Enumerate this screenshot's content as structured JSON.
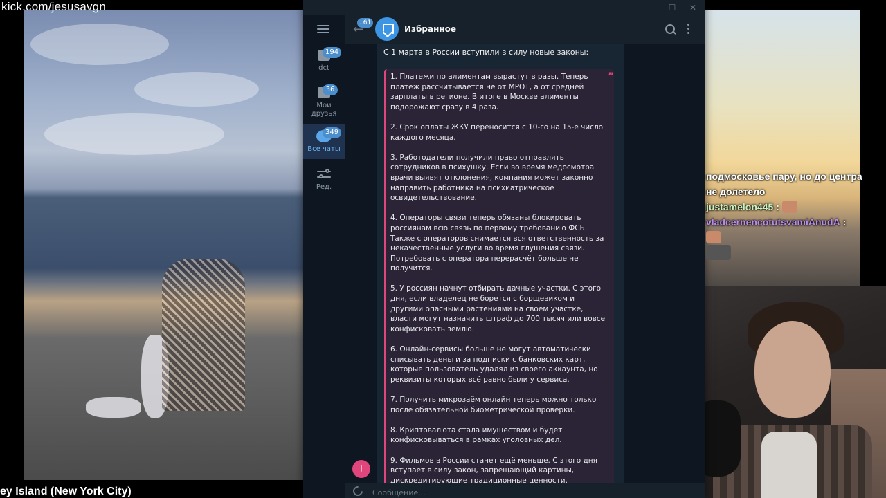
{
  "stream": {
    "url": "kick.com/jesusavgn",
    "cam_caption": "ey Island (New York City)"
  },
  "chat_overlay": {
    "line1": "подмосковье пару, но до центра",
    "line2": "не долетело",
    "user1": "justamelon445",
    "user1_sep": ":",
    "user2": "vladcernencotutsvamiAnudA",
    "user2_sep": ":"
  },
  "telegram": {
    "window_buttons": {
      "minimize": "—",
      "maximize": "☐",
      "close": "✕"
    },
    "folders": [
      {
        "label": "dct",
        "badge": "194"
      },
      {
        "label": "Мои друзья",
        "badge": "36"
      },
      {
        "label": "Все чаты",
        "badge": "349"
      },
      {
        "label": "Ред.",
        "badge": ""
      }
    ],
    "header": {
      "unread_count": "..61",
      "title": "Избранное"
    },
    "message": {
      "intro": "С 1 марта в России вступили в силу новые законы:",
      "quote_mark": "”",
      "points": [
        "1. Платежи по алиментам вырастут в разы. Теперь платёж рассчитывается не от МРОТ, а от средней зарплаты в регионе. В итоге в Москве алименты подорожают сразу в 4 раза.",
        "2. Срок оплаты ЖКУ переносится с 10-го на 15-е число каждого месяца.",
        "3. Работодатели получили право отправлять сотрудников в психушку. Если во время медосмотра врачи выявят отклонения, компания может законно направить работника на психиатрическое освидетельствование.",
        "4. Операторы связи теперь обязаны блокировать россиянам всю связь по первому требованию ФСБ. Также с операторов снимается вся ответственность за некачественные услуги во время глушения связи. Потребовать с оператора перерасчёт больше не получится.",
        "5. У россиян начнут отбирать дачные участки. С этого дня, если владелец не борется с борщевиком и другими опасными растениями на своём участке, власти могут назначить штраф до 700 тысяч или вовсе конфисковать землю.",
        "6. Онлайн-сервисы больше не могут автоматически списывать деньги за подписки с банковских карт, которые пользователь удалял из своего аккаунта, но реквизиты которых всё равно были у сервиса.",
        "7. Получить микрозаём онлайн теперь можно только после обязательной биометрической проверки.",
        "8. Криптовалюта стала имуществом и будет конфисковываться в рамках уголовных дел.",
        "9. Фильмов в России станет ещё меньше. С этого дня вступает в силу закон, запрещающий картины, дискредитирующие традиционные ценности. Кинотеатры обязаны убрать такие фильмы из офлайн- и онлайн-"
      ],
      "sender_initial": "J"
    },
    "composer": {
      "placeholder": "Сообщение..."
    }
  }
}
